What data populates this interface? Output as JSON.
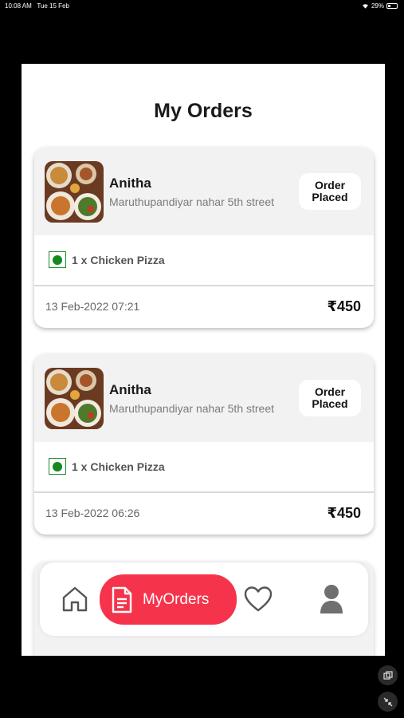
{
  "status_bar": {
    "time": "10:08 AM",
    "date": "Tue 15 Feb",
    "battery": "29%"
  },
  "page": {
    "title": "My Orders"
  },
  "orders": [
    {
      "customer_name": "Anitha",
      "address": "Maruthupandiyar nahar 5th street",
      "status": "Order Placed",
      "item": "1 x Chicken Pizza",
      "datetime": "13 Feb-2022 07:21",
      "price": "₹450"
    },
    {
      "customer_name": "Anitha",
      "address": "Maruthupandiyar nahar 5th street",
      "status": "Order Placed",
      "item": "1 x Chicken Pizza",
      "datetime": "13 Feb-2022 06:26",
      "price": "₹450"
    }
  ],
  "bottom_nav": {
    "items": [
      {
        "icon": "home-icon"
      },
      {
        "icon": "document-icon",
        "label": "MyOrders",
        "active": true
      },
      {
        "icon": "heart-icon"
      },
      {
        "icon": "profile-icon"
      }
    ]
  },
  "colors": {
    "accent": "#f5344c",
    "veg_green": "#148a1e",
    "card_header": "#f2f2f2"
  }
}
